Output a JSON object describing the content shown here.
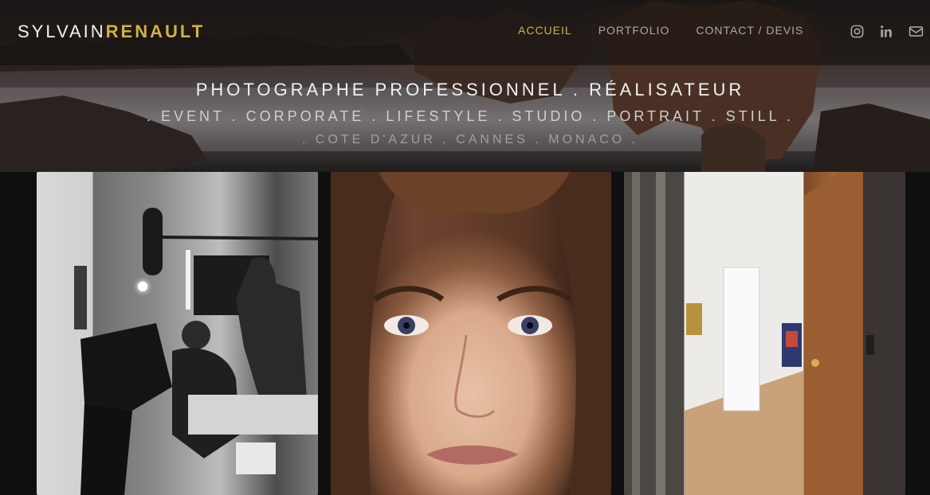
{
  "logo": {
    "first": "SYLVAIN",
    "last": "RENAULT"
  },
  "nav": [
    {
      "label": "ACCUEIL",
      "active": true
    },
    {
      "label": "PORTFOLIO",
      "active": false
    },
    {
      "label": "CONTACT / DEVIS",
      "active": false
    }
  ],
  "social": [
    "instagram-icon",
    "linkedin-icon",
    "mail-icon"
  ],
  "hero": {
    "title": "PHOTOGRAPHE PROFESSIONNEL . RÉALISATEUR",
    "services": ". EVENT . CORPORATE . LIFESTYLE . STUDIO . PORTRAIT . STILL .",
    "locations": ". COTE D'AZUR . CANNES . MONACO ."
  },
  "colors": {
    "accent": "#d1b04b",
    "background": "#0f0f10",
    "nav_inactive": "#a7a7a7"
  }
}
